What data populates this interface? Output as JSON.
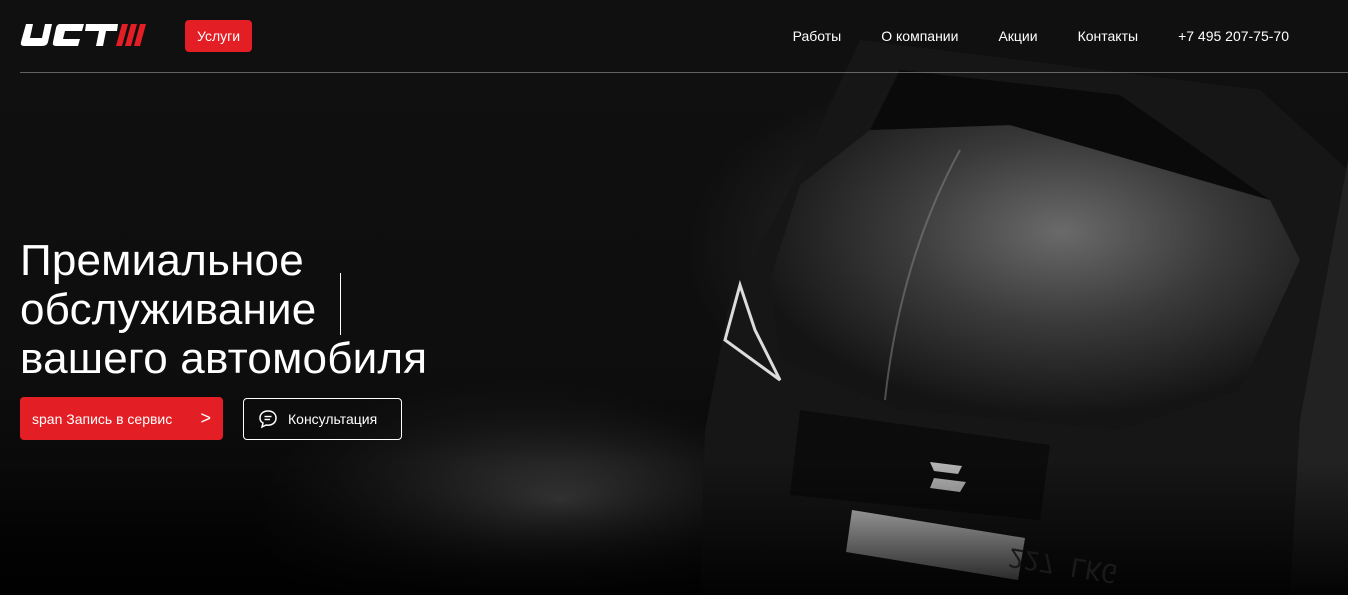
{
  "header": {
    "logo_alt": "UCT",
    "services_label": "Услуги",
    "nav": [
      {
        "label": "Работы"
      },
      {
        "label": "О компании"
      },
      {
        "label": "Акции"
      },
      {
        "label": "Контакты"
      },
      {
        "label": "+7 495 207-75-70"
      }
    ]
  },
  "hero": {
    "headline_lines": [
      "Премиальное",
      "обслуживание",
      "вашего автомобиля"
    ],
    "primary_cta": "span Запись в сервис",
    "primary_cta_icon": ">",
    "secondary_cta": "Консультация",
    "plate_text": "227 LKG"
  },
  "colors": {
    "accent": "#e31e24",
    "background": "#0b0b0b",
    "text": "#ffffff"
  },
  "icons": {
    "logo": "uct-logo",
    "chat": "chat-bubble-icon",
    "arrow": "chevron-right-icon"
  }
}
